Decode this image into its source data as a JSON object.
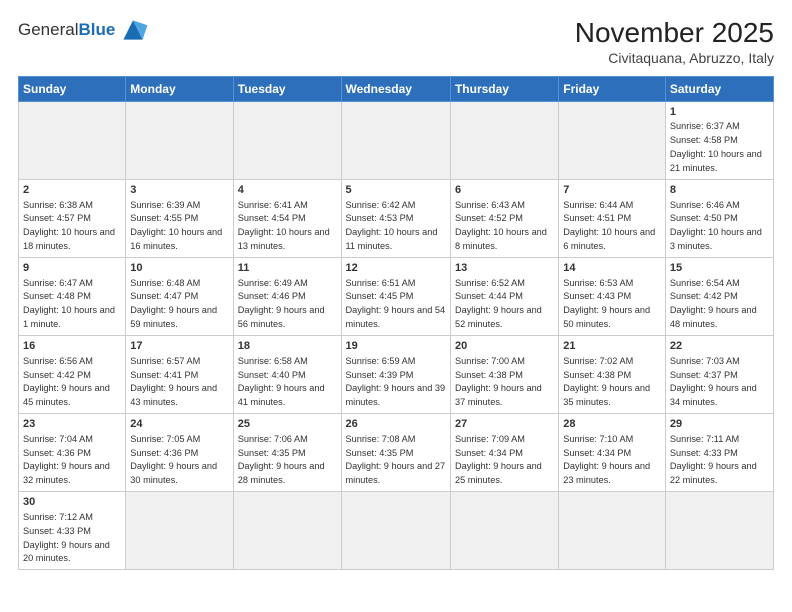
{
  "header": {
    "logo_general": "General",
    "logo_blue": "Blue",
    "month_title": "November 2025",
    "location": "Civitaquana, Abruzzo, Italy"
  },
  "days_of_week": [
    "Sunday",
    "Monday",
    "Tuesday",
    "Wednesday",
    "Thursday",
    "Friday",
    "Saturday"
  ],
  "weeks": [
    [
      {
        "day": "",
        "info": ""
      },
      {
        "day": "",
        "info": ""
      },
      {
        "day": "",
        "info": ""
      },
      {
        "day": "",
        "info": ""
      },
      {
        "day": "",
        "info": ""
      },
      {
        "day": "",
        "info": ""
      },
      {
        "day": "1",
        "info": "Sunrise: 6:37 AM\nSunset: 4:58 PM\nDaylight: 10 hours and 21 minutes."
      }
    ],
    [
      {
        "day": "2",
        "info": "Sunrise: 6:38 AM\nSunset: 4:57 PM\nDaylight: 10 hours and 18 minutes."
      },
      {
        "day": "3",
        "info": "Sunrise: 6:39 AM\nSunset: 4:55 PM\nDaylight: 10 hours and 16 minutes."
      },
      {
        "day": "4",
        "info": "Sunrise: 6:41 AM\nSunset: 4:54 PM\nDaylight: 10 hours and 13 minutes."
      },
      {
        "day": "5",
        "info": "Sunrise: 6:42 AM\nSunset: 4:53 PM\nDaylight: 10 hours and 11 minutes."
      },
      {
        "day": "6",
        "info": "Sunrise: 6:43 AM\nSunset: 4:52 PM\nDaylight: 10 hours and 8 minutes."
      },
      {
        "day": "7",
        "info": "Sunrise: 6:44 AM\nSunset: 4:51 PM\nDaylight: 10 hours and 6 minutes."
      },
      {
        "day": "8",
        "info": "Sunrise: 6:46 AM\nSunset: 4:50 PM\nDaylight: 10 hours and 3 minutes."
      }
    ],
    [
      {
        "day": "9",
        "info": "Sunrise: 6:47 AM\nSunset: 4:48 PM\nDaylight: 10 hours and 1 minute."
      },
      {
        "day": "10",
        "info": "Sunrise: 6:48 AM\nSunset: 4:47 PM\nDaylight: 9 hours and 59 minutes."
      },
      {
        "day": "11",
        "info": "Sunrise: 6:49 AM\nSunset: 4:46 PM\nDaylight: 9 hours and 56 minutes."
      },
      {
        "day": "12",
        "info": "Sunrise: 6:51 AM\nSunset: 4:45 PM\nDaylight: 9 hours and 54 minutes."
      },
      {
        "day": "13",
        "info": "Sunrise: 6:52 AM\nSunset: 4:44 PM\nDaylight: 9 hours and 52 minutes."
      },
      {
        "day": "14",
        "info": "Sunrise: 6:53 AM\nSunset: 4:43 PM\nDaylight: 9 hours and 50 minutes."
      },
      {
        "day": "15",
        "info": "Sunrise: 6:54 AM\nSunset: 4:42 PM\nDaylight: 9 hours and 48 minutes."
      }
    ],
    [
      {
        "day": "16",
        "info": "Sunrise: 6:56 AM\nSunset: 4:42 PM\nDaylight: 9 hours and 45 minutes."
      },
      {
        "day": "17",
        "info": "Sunrise: 6:57 AM\nSunset: 4:41 PM\nDaylight: 9 hours and 43 minutes."
      },
      {
        "day": "18",
        "info": "Sunrise: 6:58 AM\nSunset: 4:40 PM\nDaylight: 9 hours and 41 minutes."
      },
      {
        "day": "19",
        "info": "Sunrise: 6:59 AM\nSunset: 4:39 PM\nDaylight: 9 hours and 39 minutes."
      },
      {
        "day": "20",
        "info": "Sunrise: 7:00 AM\nSunset: 4:38 PM\nDaylight: 9 hours and 37 minutes."
      },
      {
        "day": "21",
        "info": "Sunrise: 7:02 AM\nSunset: 4:38 PM\nDaylight: 9 hours and 35 minutes."
      },
      {
        "day": "22",
        "info": "Sunrise: 7:03 AM\nSunset: 4:37 PM\nDaylight: 9 hours and 34 minutes."
      }
    ],
    [
      {
        "day": "23",
        "info": "Sunrise: 7:04 AM\nSunset: 4:36 PM\nDaylight: 9 hours and 32 minutes."
      },
      {
        "day": "24",
        "info": "Sunrise: 7:05 AM\nSunset: 4:36 PM\nDaylight: 9 hours and 30 minutes."
      },
      {
        "day": "25",
        "info": "Sunrise: 7:06 AM\nSunset: 4:35 PM\nDaylight: 9 hours and 28 minutes."
      },
      {
        "day": "26",
        "info": "Sunrise: 7:08 AM\nSunset: 4:35 PM\nDaylight: 9 hours and 27 minutes."
      },
      {
        "day": "27",
        "info": "Sunrise: 7:09 AM\nSunset: 4:34 PM\nDaylight: 9 hours and 25 minutes."
      },
      {
        "day": "28",
        "info": "Sunrise: 7:10 AM\nSunset: 4:34 PM\nDaylight: 9 hours and 23 minutes."
      },
      {
        "day": "29",
        "info": "Sunrise: 7:11 AM\nSunset: 4:33 PM\nDaylight: 9 hours and 22 minutes."
      }
    ],
    [
      {
        "day": "30",
        "info": "Sunrise: 7:12 AM\nSunset: 4:33 PM\nDaylight: 9 hours and 20 minutes."
      },
      {
        "day": "",
        "info": ""
      },
      {
        "day": "",
        "info": ""
      },
      {
        "day": "",
        "info": ""
      },
      {
        "day": "",
        "info": ""
      },
      {
        "day": "",
        "info": ""
      },
      {
        "day": "",
        "info": ""
      }
    ]
  ]
}
